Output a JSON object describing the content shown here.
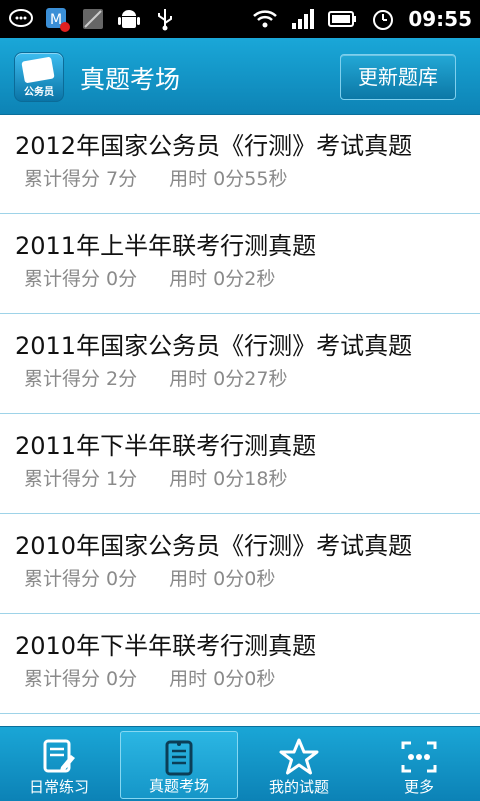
{
  "status_bar": {
    "time": "09:55",
    "icons": [
      "chat-icon",
      "security-app-icon",
      "no-signal-icon",
      "android-icon",
      "usb-icon",
      "wifi-icon",
      "signal-icon",
      "battery-icon",
      "alarm-icon"
    ]
  },
  "header": {
    "logo_text": "公务员",
    "title": "真题考场",
    "update_button": "更新题库"
  },
  "list": {
    "items": [
      {
        "title": "2012年国家公务员《行测》考试真题",
        "score": "累计得分 7分",
        "time": "用时 0分55秒"
      },
      {
        "title": "2011年上半年联考行测真题",
        "score": "累计得分 0分",
        "time": "用时 0分2秒"
      },
      {
        "title": "2011年国家公务员《行测》考试真题",
        "score": "累计得分 2分",
        "time": "用时 0分27秒"
      },
      {
        "title": "2011年下半年联考行测真题",
        "score": "累计得分 1分",
        "time": "用时 0分18秒"
      },
      {
        "title": "2010年国家公务员《行测》考试真题",
        "score": "累计得分 0分",
        "time": "用时 0分0秒"
      },
      {
        "title": "2010年下半年联考行测真题",
        "score": "累计得分 0分",
        "time": "用时 0分0秒"
      }
    ]
  },
  "tabs": [
    {
      "label": "日常练习",
      "icon": "edit-icon",
      "active": false
    },
    {
      "label": "真题考场",
      "icon": "notebook-icon",
      "active": true
    },
    {
      "label": "我的试题",
      "icon": "star-icon",
      "active": false
    },
    {
      "label": "更多",
      "icon": "more-icon",
      "active": false
    }
  ],
  "colors": {
    "header": "#1aa7d8",
    "divider": "#9ed3e8",
    "meta_text": "#8a8a8a"
  }
}
